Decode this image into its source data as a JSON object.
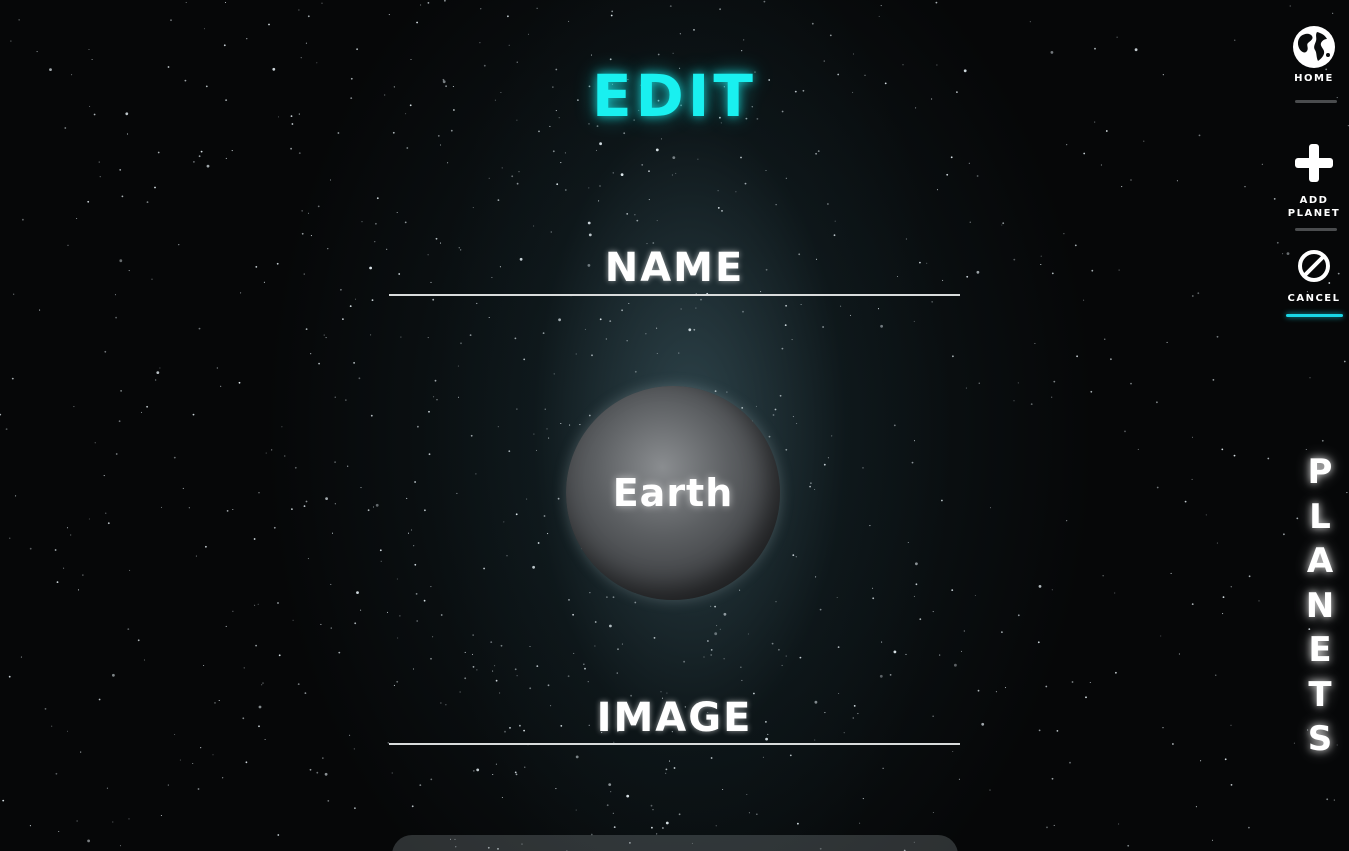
{
  "page": {
    "title": "EDIT"
  },
  "form": {
    "name_placeholder": "NAME",
    "image_placeholder": "IMAGE"
  },
  "planet": {
    "label": "Earth"
  },
  "nav": {
    "home_label": "HOME",
    "add_label_line1": "ADD",
    "add_label_line2": "PLANET",
    "cancel_label": "CANCEL",
    "home_icon": "globe-icon",
    "add_icon": "plus-icon",
    "cancel_icon": "cancel-icon"
  },
  "side_title": [
    "P",
    "L",
    "A",
    "N",
    "E",
    "T",
    "S"
  ],
  "colors": {
    "accent": "#19f0f0",
    "active_underline": "#19d6e6",
    "text": "#ffffff"
  }
}
